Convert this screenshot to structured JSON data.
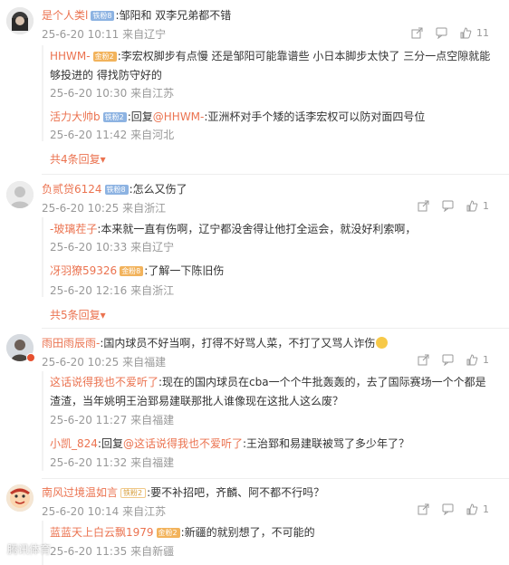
{
  "comments": [
    {
      "user": "是个人类l",
      "badge": "铁粉8",
      "text": ":邹阳和 双李兄弟都不错",
      "time": "25-6-20 10:11",
      "location": "来自辽宁",
      "likes": "11",
      "replies": [
        {
          "user": "HHWM-",
          "badge": "金粉2",
          "text": ":李宏权脚步有点慢 还是邹阳可能靠谱些 小日本脚步太快了 三分一点空隙就能够投进的 得找防守好的",
          "time": "25-6-20 10:30",
          "location": "来自江苏"
        },
        {
          "user": "活力大帅b",
          "badge": "铁粉2",
          "reply_prefix": ":回复",
          "at": "@HHWM-",
          "text": ":亚洲杯对手个矮的话李宏权可以防对面四号位",
          "time": "25-6-20 11:42",
          "location": "来自河北"
        }
      ],
      "more": "共4条回复"
    },
    {
      "user": "负贰贷6124",
      "badge": "铁粉8",
      "text": ":怎么又伤了",
      "time": "25-6-20 10:25",
      "location": "来自浙江",
      "likes": "1",
      "replies": [
        {
          "user": "-玻璃茬子",
          "text": ":本来就一直有伤啊，辽宁都没舍得让他打全运会，就没好利索啊，",
          "time": "25-6-20 10:33",
          "location": "来自辽宁"
        },
        {
          "user": "冴羽獠59326",
          "badge": "金粉8",
          "text": ":了解一下陈旧伤",
          "time": "25-6-20 12:16",
          "location": "来自浙江"
        }
      ],
      "more": "共5条回复"
    },
    {
      "user": "雨田雨辰雨-",
      "text": ":国内球员不好当啊，打得不好骂人菜，不打了又骂人诈伤",
      "time": "25-6-20 10:25",
      "location": "来自福建",
      "likes": "1",
      "replies": [
        {
          "user": "这话说得我也不爱听了",
          "text": ":现在的国内球员在cba一个个牛批轰轰的，去了国际赛场一个个都是渣渣，当年姚明王治郅易建联那批人谁像现在这批人这么废？",
          "time": "25-6-20 11:27",
          "location": "来自福建"
        },
        {
          "user": "小凯_824",
          "reply_prefix": ":回复",
          "at": "@这话说得我也不爱听了",
          "text": ":王治郅和易建联被骂了多少年了？",
          "time": "25-6-20 11:32",
          "location": "来自福建"
        }
      ]
    },
    {
      "user": "南风过境温如言",
      "badge": "铁粉2",
      "text": ":要不补招吧，齐麟、阿不都不行吗？",
      "time": "25-6-20 10:14",
      "location": "来自江苏",
      "likes": "1",
      "replies": [
        {
          "user": "蓝蓝天上白云飘1979",
          "badge": "金粉2",
          "text": ":新疆的就别想了，不可能的",
          "time": "25-6-20 11:35",
          "location": "来自新疆"
        }
      ]
    }
  ],
  "watermark": "腾讯体育"
}
